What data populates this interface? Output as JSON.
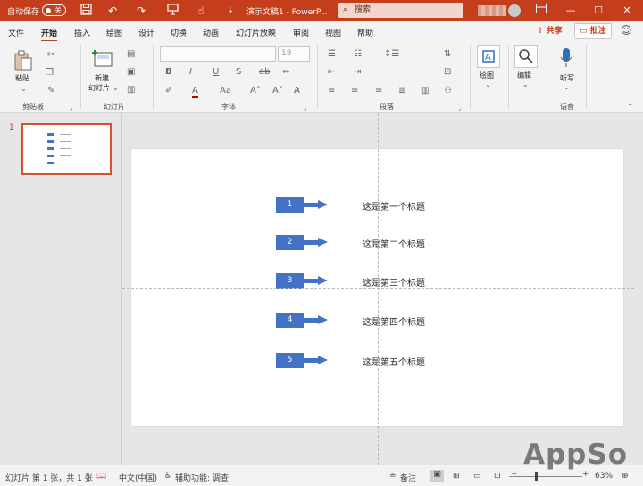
{
  "titlebar": {
    "autosave_label": "自动保存",
    "autosave_state": "关",
    "doc_title": "演示文稿1  -  PowerP...",
    "search_placeholder": "搜索"
  },
  "menu": {
    "tabs": [
      "文件",
      "开始",
      "插入",
      "绘图",
      "设计",
      "切换",
      "动画",
      "幻灯片放映",
      "审阅",
      "视图",
      "帮助"
    ],
    "active_tab": "开始",
    "share_label": "共享",
    "comment_label": "批注"
  },
  "ribbon": {
    "paste_label": "粘贴",
    "new_slide_label_1": "新建",
    "new_slide_label_2": "幻灯片",
    "font_size": "18",
    "draw_label": "绘图",
    "edit_label": "编辑",
    "dictate_label": "听写",
    "groups": [
      "剪贴板",
      "幻灯片",
      "字体",
      "段落",
      "语音"
    ]
  },
  "thumbnail": {
    "number": "1"
  },
  "slide": {
    "items": [
      {
        "num": "1",
        "label": "这是第一个标题"
      },
      {
        "num": "2",
        "label": "这是第二个标题"
      },
      {
        "num": "3",
        "label": "这是第三个标题"
      },
      {
        "num": "4",
        "label": "这是第四个标题"
      },
      {
        "num": "5",
        "label": "这是第五个标题"
      }
    ]
  },
  "statusbar": {
    "slide_info": "幻灯片 第 1 张，共 1 张",
    "language": "中文(中国)",
    "accessibility": "辅助功能: 调查",
    "notes": "备注",
    "zoom": "63%"
  },
  "watermark": "AppSo",
  "colors": {
    "accent": "#c43e1c",
    "shape": "#4472c4"
  }
}
